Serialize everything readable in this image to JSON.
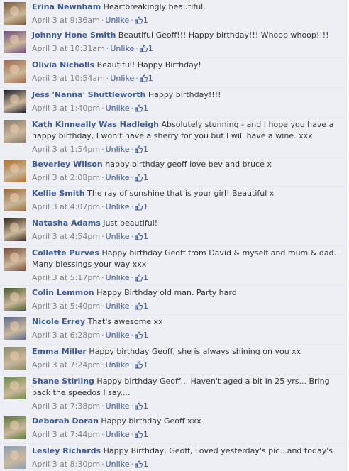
{
  "comments": [
    {
      "name": "Erina Newnham",
      "text": "Heartbreakingly beautiful.",
      "time": "April 3 at 9:36am",
      "action": "Unlike",
      "likes": "1",
      "avatar": "#7a5a3a"
    },
    {
      "name": "Johnny Hone Smith",
      "text": "Beautiful Geoff!!! Happy birthday!!! Whoop whoop!!!!",
      "time": "April 3 at 10:31am",
      "action": "Unlike",
      "likes": "1",
      "avatar": "#6a4b7d"
    },
    {
      "name": "Olivia Nicholls",
      "text": "Beautiful! Happy Birthday!",
      "time": "April 3 at 10:54am",
      "action": "Unlike",
      "likes": "1",
      "avatar": "#a06a4a"
    },
    {
      "name": "Jess 'Nanna' Shuttleworth",
      "text": "Happy birthday!!!!",
      "time": "April 3 at 1:40pm",
      "action": "Unlike",
      "likes": "1",
      "avatar": "#1e1e2a"
    },
    {
      "name": "Kath Kinneally Was Hadleigh",
      "text": "Absolutely stunning - and I hope you have a happy birthday, I won't have a sherry for you but I will have a wine. xxx",
      "time": "April 3 at 1:54pm",
      "action": "Unlike",
      "likes": "1",
      "avatar": "#8a7a6a"
    },
    {
      "name": "Beverley Wilson",
      "text": "happy birthday geoff love bev and bruce x",
      "time": "April 3 at 2:08pm",
      "action": "Unlike",
      "likes": "1",
      "avatar": "#b0702a"
    },
    {
      "name": "Kellie Smith",
      "text": "The ray of sunshine that is your girl! Beautiful x",
      "time": "April 3 at 4:07pm",
      "action": "Unlike",
      "likes": "1",
      "avatar": "#9a6a3a"
    },
    {
      "name": "Natasha Adams",
      "text": "Just beautiful!",
      "time": "April 3 at 4:54pm",
      "action": "Unlike",
      "likes": "1",
      "avatar": "#3a2a1e"
    },
    {
      "name": "Collette Purves",
      "text": "Happy birthday Geoff from David & myself and mum & dad. Many blessings your way xxx",
      "time": "April 3 at 5:17pm",
      "action": "Unlike",
      "likes": "1",
      "avatar": "#7a4a3a"
    },
    {
      "name": "Colin Lemmon",
      "text": "Happy Birthday old man. Party hard",
      "time": "April 3 at 5:40pm",
      "action": "Unlike",
      "likes": "1",
      "avatar": "#4a5a2a"
    },
    {
      "name": "Nicole Errey",
      "text": "That's awesome xx",
      "time": "April 3 at 6:28pm",
      "action": "Unlike",
      "likes": "1",
      "avatar": "#5a6a8a"
    },
    {
      "name": "Emma Miller",
      "text": "Happy birthday Geoff, she is always shining on you xx",
      "time": "April 3 at 7:24pm",
      "action": "Unlike",
      "likes": "1",
      "avatar": "#8a8a6a"
    },
    {
      "name": "Shane Stirling",
      "text": "Happy birthday Geoff... Haven't aged a bit in 25 yrs... Bring back the speedos I say....",
      "time": "April 3 at 7:38pm",
      "action": "Unlike",
      "likes": "1",
      "avatar": "#6a8a4a"
    },
    {
      "name": "Deborah Doran",
      "text": "Happy birthday Geoff xxx",
      "time": "April 3 at 7:44pm",
      "action": "Unlike",
      "likes": "1",
      "avatar": "#5a7a3a"
    },
    {
      "name": "Lesley Richards",
      "text": "Happy Birthday, Geoff, Loved yesterday's pic...and today's",
      "time": "April 3 at 8:30pm",
      "action": "Unlike",
      "likes": "1",
      "avatar": "#8aa0b8"
    }
  ]
}
